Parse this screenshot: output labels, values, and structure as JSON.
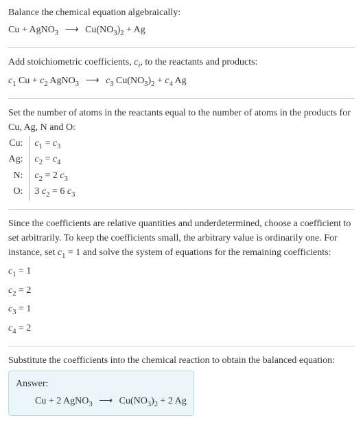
{
  "s1_title": "Balance the chemical equation algebraically:",
  "s1_eq_lhs1": "Cu",
  "s1_eq_plus1": " + ",
  "s1_eq_lhs2": "AgNO",
  "s1_eq_lhs2_sub": "3",
  "s1_arrow": "⟶",
  "s1_eq_rhs1": "Cu(NO",
  "s1_eq_rhs1_sub1": "3",
  "s1_eq_rhs1_mid": ")",
  "s1_eq_rhs1_sub2": "2",
  "s1_eq_plus2": " + ",
  "s1_eq_rhs2": "Ag",
  "s2_title_a": "Add stoichiometric coefficients, ",
  "s2_ci_c": "c",
  "s2_ci_i": "i",
  "s2_title_b": ", to the reactants and products:",
  "s2_c1_c": "c",
  "s2_c1_n": "1",
  "s2_sp1": " Cu",
  "s2_plus1": " + ",
  "s2_c2_c": "c",
  "s2_c2_n": "2",
  "s2_sp2": " AgNO",
  "s2_sp2_sub": "3",
  "s2_arrow": "⟶",
  "s2_c3_c": "c",
  "s2_c3_n": "3",
  "s2_sp3": " Cu(NO",
  "s2_sp3_sub1": "3",
  "s2_sp3_mid": ")",
  "s2_sp3_sub2": "2",
  "s2_plus2": " + ",
  "s2_c4_c": "c",
  "s2_c4_n": "4",
  "s2_sp4": " Ag",
  "s3_title": "Set the number of atoms in the reactants equal to the number of atoms in the products for Cu, Ag, N and O:",
  "rows": [
    {
      "el": "Cu:",
      "lc": "c",
      "ln": "1",
      "pre": "",
      "eq": " = ",
      "rpre": "",
      "rc": "c",
      "rn": "3"
    },
    {
      "el": "Ag:",
      "lc": "c",
      "ln": "2",
      "pre": "",
      "eq": " = ",
      "rpre": "",
      "rc": "c",
      "rn": "4"
    },
    {
      "el": "N:",
      "lc": "c",
      "ln": "2",
      "pre": "",
      "eq": " = ",
      "rpre": "2 ",
      "rc": "c",
      "rn": "3"
    },
    {
      "el": "O:",
      "lc": "c",
      "ln": "2",
      "pre": "3 ",
      "eq": " = ",
      "rpre": "6 ",
      "rc": "c",
      "rn": "3"
    }
  ],
  "s4_title_a": "Since the coefficients are relative quantities and underdetermined, choose a coefficient to set arbitrarily. To keep the coefficients small, the arbitrary value is ordinarily one. For instance, set ",
  "s4_c1_c": "c",
  "s4_c1_n": "1",
  "s4_title_b": " = 1 and solve the system of equations for the remaining coefficients:",
  "coeffs": [
    {
      "c": "c",
      "n": "1",
      "eq": " = 1"
    },
    {
      "c": "c",
      "n": "2",
      "eq": " = 2"
    },
    {
      "c": "c",
      "n": "3",
      "eq": " = 1"
    },
    {
      "c": "c",
      "n": "4",
      "eq": " = 2"
    }
  ],
  "s5_title": "Substitute the coefficients into the chemical reaction to obtain the balanced equation:",
  "ans_label": "Answer:",
  "ans_lhs1": "Cu",
  "ans_plus1": " + ",
  "ans_lhs2a": "2 AgNO",
  "ans_lhs2_sub": "3",
  "ans_arrow": "⟶",
  "ans_rhs1a": "Cu(NO",
  "ans_rhs1_sub1": "3",
  "ans_rhs1_mid": ")",
  "ans_rhs1_sub2": "2",
  "ans_plus2": " + ",
  "ans_rhs2": "2 Ag"
}
